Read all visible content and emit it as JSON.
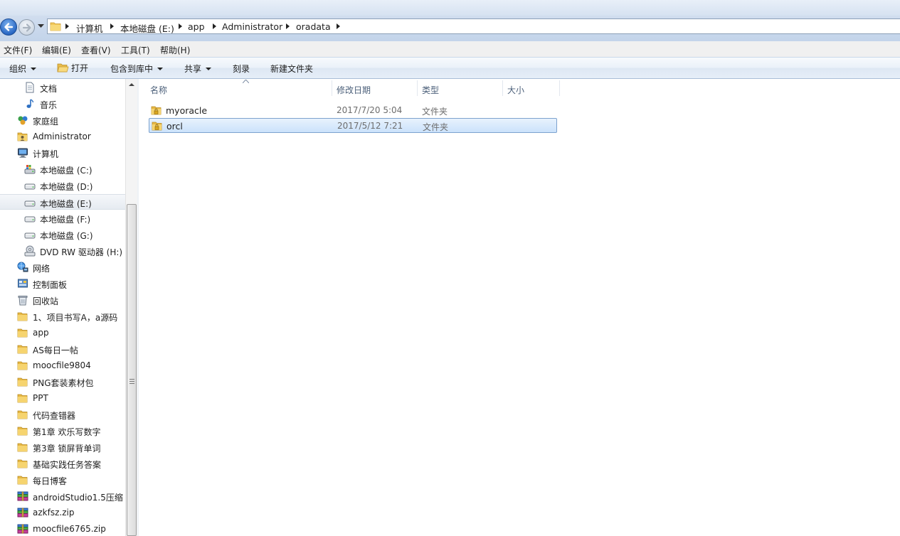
{
  "address": {
    "crumbs": [
      "计算机",
      "本地磁盘 (E:)",
      "app",
      "Administrator",
      "oradata"
    ]
  },
  "menu": [
    "文件(F)",
    "编辑(E)",
    "查看(V)",
    "工具(T)",
    "帮助(H)"
  ],
  "toolbar": {
    "organize": "组织",
    "open": "打开",
    "include_in_library": "包含到库中",
    "share": "共享",
    "burn": "刻录",
    "new_folder": "新建文件夹"
  },
  "nav": [
    {
      "label": "文档",
      "icon": "document-icon",
      "indent": 2
    },
    {
      "label": "音乐",
      "icon": "music-icon",
      "indent": 2
    },
    {
      "label": "家庭组",
      "icon": "homegroup-icon",
      "indent": 1
    },
    {
      "label": "Administrator",
      "icon": "user-folder-icon",
      "indent": 1
    },
    {
      "label": "计算机",
      "icon": "computer-icon",
      "indent": 1
    },
    {
      "label": "本地磁盘 (C:)",
      "icon": "system-drive-icon",
      "indent": 2
    },
    {
      "label": "本地磁盘 (D:)",
      "icon": "drive-icon",
      "indent": 2
    },
    {
      "label": "本地磁盘 (E:)",
      "icon": "drive-icon",
      "indent": 2,
      "selected": true
    },
    {
      "label": "本地磁盘 (F:)",
      "icon": "drive-icon",
      "indent": 2
    },
    {
      "label": "本地磁盘 (G:)",
      "icon": "drive-icon",
      "indent": 2
    },
    {
      "label": "DVD RW 驱动器 (H:)",
      "icon": "dvd-drive-icon",
      "indent": 2
    },
    {
      "label": "网络",
      "icon": "network-icon",
      "indent": 1
    },
    {
      "label": "控制面板",
      "icon": "control-panel-icon",
      "indent": 1
    },
    {
      "label": "回收站",
      "icon": "recycle-bin-icon",
      "indent": 1
    },
    {
      "label": "1、项目书写A，a源码",
      "icon": "folder-icon",
      "indent": 1
    },
    {
      "label": "app",
      "icon": "folder-icon",
      "indent": 1
    },
    {
      "label": "AS每日一帖",
      "icon": "folder-icon",
      "indent": 1
    },
    {
      "label": "moocfile9804",
      "icon": "folder-icon",
      "indent": 1
    },
    {
      "label": "PNG套装素材包",
      "icon": "folder-icon",
      "indent": 1
    },
    {
      "label": "PPT",
      "icon": "folder-icon",
      "indent": 1
    },
    {
      "label": "代码查错器",
      "icon": "folder-icon",
      "indent": 1
    },
    {
      "label": "第1章 欢乐写数字",
      "icon": "folder-icon",
      "indent": 1
    },
    {
      "label": "第3章 锁屏背单词",
      "icon": "folder-icon",
      "indent": 1
    },
    {
      "label": "基础实践任务答案",
      "icon": "folder-icon",
      "indent": 1
    },
    {
      "label": "每日博客",
      "icon": "folder-icon",
      "indent": 1
    },
    {
      "label": "androidStudio1.5压缩",
      "icon": "archive-icon",
      "indent": 1
    },
    {
      "label": "azkfsz.zip",
      "icon": "archive-icon",
      "indent": 1
    },
    {
      "label": "moocfile6765.zip",
      "icon": "archive-icon",
      "indent": 1
    }
  ],
  "columns": {
    "name": "名称",
    "modified": "修改日期",
    "type": "类型",
    "size": "大小"
  },
  "files": [
    {
      "name": "myoracle",
      "modified": "2017/7/20 5:04",
      "type": "文件夹",
      "selected": false
    },
    {
      "name": "orcl",
      "modified": "2017/5/12 7:21",
      "type": "文件夹",
      "selected": true
    }
  ]
}
